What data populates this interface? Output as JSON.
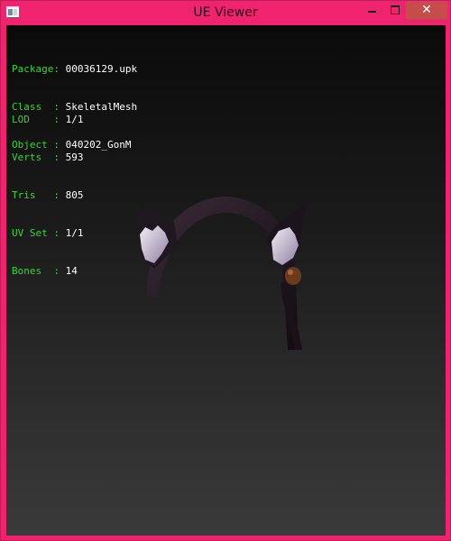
{
  "window": {
    "title": "UE Viewer",
    "controls": {
      "minimize": "minimize",
      "maximize": "maximize",
      "close": "✕"
    }
  },
  "info": {
    "group1": [
      {
        "label": "Package:",
        "value": "00036129.upk"
      },
      {
        "label": "Class  :",
        "value": "SkeletalMesh"
      },
      {
        "label": "Object :",
        "value": "040202_GonM"
      }
    ],
    "group2": [
      {
        "label": "LOD    :",
        "value": "1/1"
      },
      {
        "label": "Verts  :",
        "value": "593"
      },
      {
        "label": "Tris   :",
        "value": "805"
      },
      {
        "label": "UV Set :",
        "value": "1/1"
      },
      {
        "label": "Bones  :",
        "value": "14"
      }
    ]
  },
  "colors": {
    "frame": "#f0246e",
    "label_green": "#3cd23c",
    "value_white": "#ffffff",
    "close_red": "#c74c4c"
  },
  "icons": [
    "app-icon",
    "minimize-icon",
    "maximize-icon",
    "close-icon"
  ]
}
